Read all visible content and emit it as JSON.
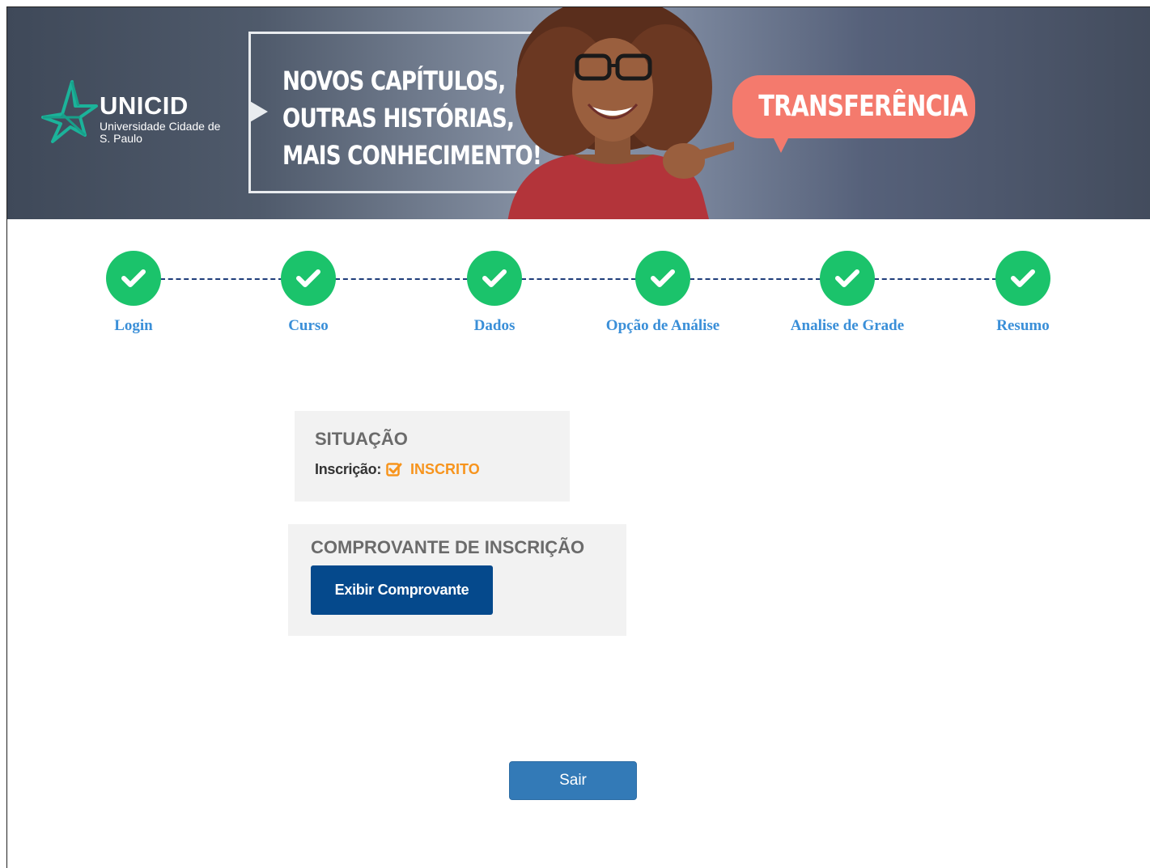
{
  "banner": {
    "brand": "UNICID",
    "brand_sub": "Universidade Cidade de S. Paulo",
    "headline": [
      "NOVOS CAPÍTULOS,",
      "OUTRAS HISTÓRIAS,",
      "MAIS CONHECIMENTO!"
    ],
    "bubble": "TRANSFERÊNCIA"
  },
  "steps": [
    {
      "label": "Login",
      "status": "complete"
    },
    {
      "label": "Curso",
      "status": "complete"
    },
    {
      "label": "Dados",
      "status": "complete"
    },
    {
      "label": "Opção de Análise",
      "status": "complete"
    },
    {
      "label": "Analise de Grade",
      "status": "complete"
    },
    {
      "label": "Resumo",
      "status": "complete"
    }
  ],
  "situacao": {
    "title": "SITUAÇÃO",
    "label": "Inscrição:",
    "status": "INSCRITO"
  },
  "comprovante": {
    "title": "COMPROVANTE DE INSCRIÇÃO",
    "button": "Exibir Comprovante"
  },
  "sair_button": "Sair",
  "colors": {
    "step_complete": "#1bc36b",
    "step_label": "#3a8fd8",
    "status_orange": "#f7941d",
    "primary_dark": "#05498c",
    "primary": "#337ab7",
    "bubble": "#f47a6d"
  },
  "icons": {
    "step": "check-icon",
    "status": "checkbox-check-icon",
    "logo": "star-logo-icon"
  }
}
